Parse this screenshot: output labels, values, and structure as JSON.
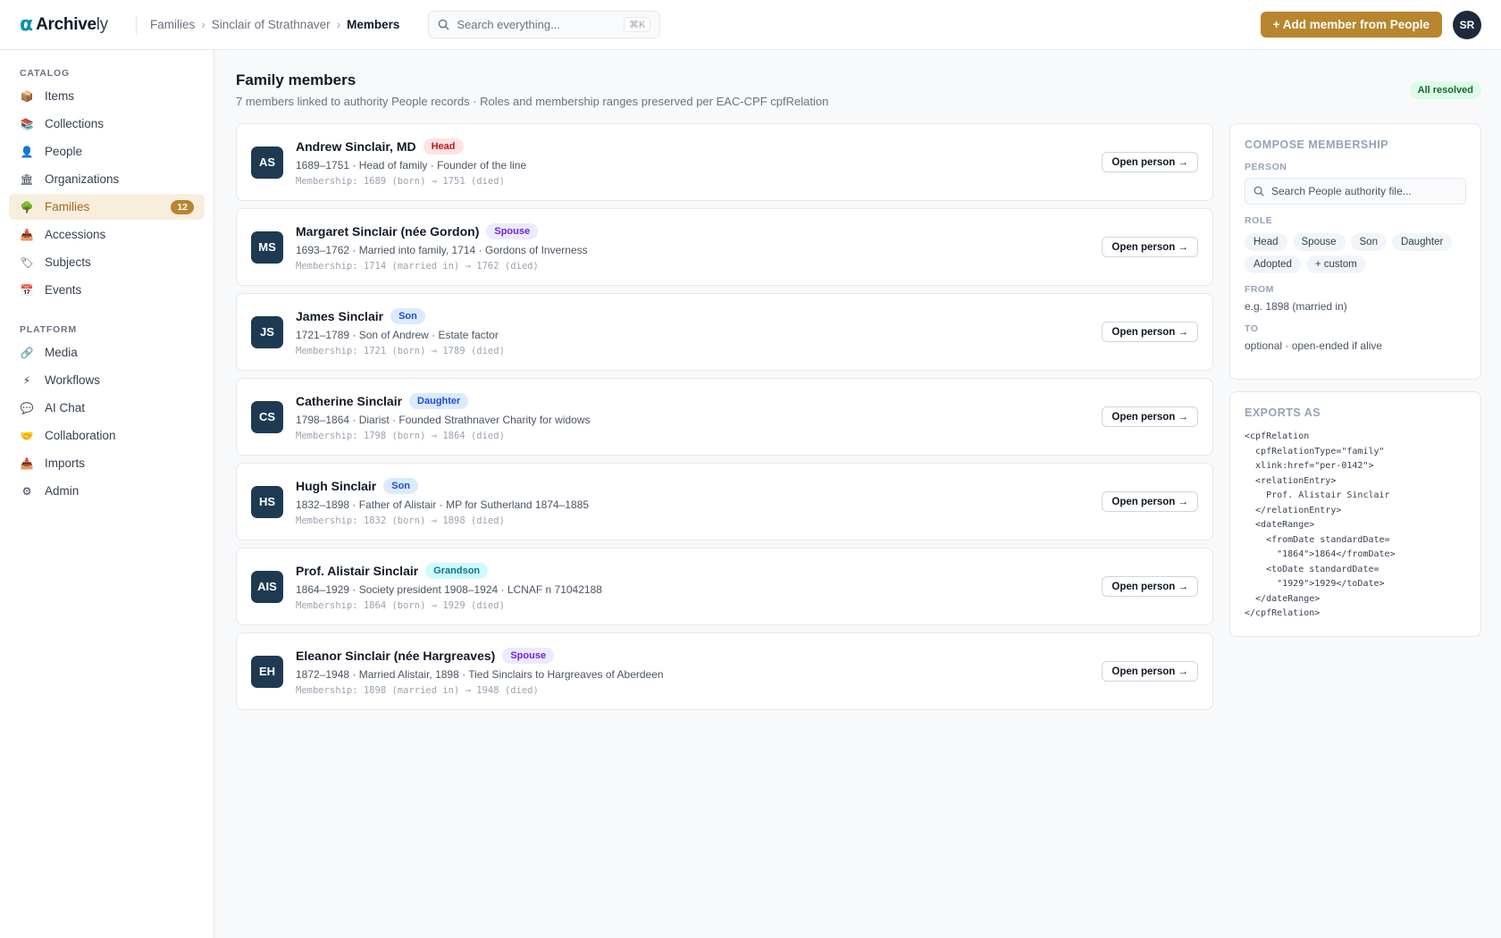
{
  "brand": {
    "mark": "α",
    "name_bold": "Archive",
    "name_thin": "ly"
  },
  "breadcrumb": [
    "Families",
    "Sinclair of Strathnaver",
    "Members"
  ],
  "search": {
    "placeholder": "Search everything...",
    "shortcut": "⌘K"
  },
  "header": {
    "add_button": "+ Add member from People",
    "user_initials": "SR"
  },
  "sidebar": {
    "catalog_label": "CATALOG",
    "catalog": [
      {
        "label": "Items",
        "icon": "📦"
      },
      {
        "label": "Collections",
        "icon": "📚"
      },
      {
        "label": "People",
        "icon": "👤"
      },
      {
        "label": "Organizations",
        "icon": "🏛"
      },
      {
        "label": "Families",
        "icon": "🌳",
        "badge": "12"
      },
      {
        "label": "Accessions",
        "icon": "📥"
      },
      {
        "label": "Subjects",
        "icon": "🏷"
      },
      {
        "label": "Events",
        "icon": "📅"
      }
    ],
    "platform_label": "PLATFORM",
    "platform": [
      {
        "label": "Media",
        "icon": "🔗"
      },
      {
        "label": "Workflows",
        "icon": "⚡"
      },
      {
        "label": "AI Chat",
        "icon": "💬"
      },
      {
        "label": "Collaboration",
        "icon": "🤝"
      },
      {
        "label": "Imports",
        "icon": "📥"
      },
      {
        "label": "Admin",
        "icon": "⚙"
      }
    ]
  },
  "main": {
    "title": "Family members",
    "subtitle": "7 members linked to authority People records · Roles and membership ranges preserved per EAC-CPF cpfRelation",
    "status": "All resolved",
    "open_label": "Open person →",
    "members": [
      {
        "initials": "AS",
        "name": "Andrew Sinclair, MD",
        "role": "Head",
        "role_class": "head",
        "meta": "1689–1751 · Head of family · Founder of the line",
        "membership": "Membership: 1689 (born) → 1751 (died)"
      },
      {
        "initials": "MS",
        "name": "Margaret Sinclair (née Gordon)",
        "role": "Spouse",
        "role_class": "spouse",
        "meta": "1693–1762 · Married into family, 1714 · Gordons of Inverness",
        "membership": "Membership: 1714 (married in) → 1762 (died)"
      },
      {
        "initials": "JS",
        "name": "James Sinclair",
        "role": "Son",
        "role_class": "son",
        "meta": "1721–1789 · Son of Andrew · Estate factor",
        "membership": "Membership: 1721 (born) → 1789 (died)"
      },
      {
        "initials": "CS",
        "name": "Catherine Sinclair",
        "role": "Daughter",
        "role_class": "daughter",
        "meta": "1798–1864 · Diarist · Founded Strathnaver Charity for widows",
        "membership": "Membership: 1798 (born) → 1864 (died)"
      },
      {
        "initials": "HS",
        "name": "Hugh Sinclair",
        "role": "Son",
        "role_class": "son",
        "meta": "1832–1898 · Father of Alistair · MP for Sutherland 1874–1885",
        "membership": "Membership: 1832 (born) → 1898 (died)"
      },
      {
        "initials": "AIS",
        "name": "Prof. Alistair Sinclair",
        "role": "Grandson",
        "role_class": "grandson",
        "meta": "1864–1929 · Society president 1908–1924 · LCNAF n 71042188",
        "membership": "Membership: 1864 (born) → 1929 (died)"
      },
      {
        "initials": "EH",
        "name": "Eleanor Sinclair (née Hargreaves)",
        "role": "Spouse",
        "role_class": "spouse",
        "meta": "1872–1948 · Married Alistair, 1898 · Tied Sinclairs to Hargreaves of Aberdeen",
        "membership": "Membership: 1898 (married in) → 1948 (died)"
      }
    ]
  },
  "compose": {
    "title": "COMPOSE MEMBERSHIP",
    "person_label": "PERSON",
    "person_placeholder": "Search People authority file...",
    "role_label": "ROLE",
    "roles": [
      "Head",
      "Spouse",
      "Son",
      "Daughter",
      "Adopted",
      "+ custom"
    ],
    "from_label": "FROM",
    "from_value": "e.g. 1898 (married in)",
    "to_label": "TO",
    "to_value": "optional · open-ended if alive"
  },
  "exports": {
    "title": "EXPORTS AS",
    "code": "<cpfRelation\n  cpfRelationType=\"family\"\n  xlink:href=\"per-0142\">\n  <relationEntry>\n    Prof. Alistair Sinclair\n  </relationEntry>\n  <dateRange>\n    <fromDate standardDate=\n      \"1864\">1864</fromDate>\n    <toDate standardDate=\n      \"1929\">1929</toDate>\n  </dateRange>\n</cpfRelation>"
  }
}
